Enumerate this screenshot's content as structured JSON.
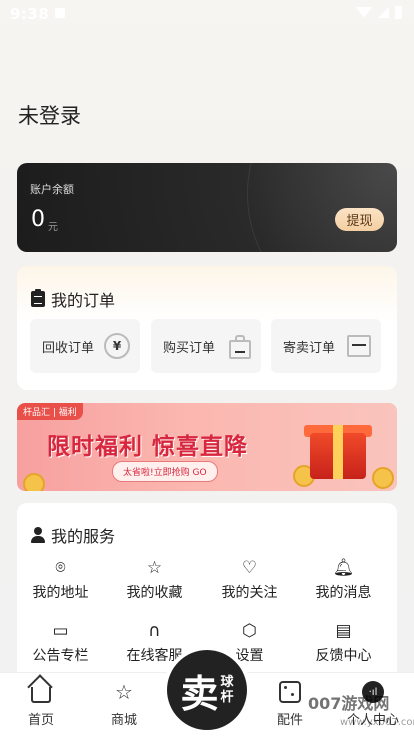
{
  "status_bar": {
    "time": "9:38"
  },
  "profile": {
    "login_status": "未登录"
  },
  "balance": {
    "label": "账户余额",
    "amount": "0",
    "unit": "元",
    "withdraw_label": "提现"
  },
  "orders": {
    "title": "我的订单",
    "items": [
      {
        "label": "回收订单",
        "icon": "yen-icon"
      },
      {
        "label": "购买订单",
        "icon": "shopping-bag-icon"
      },
      {
        "label": "寄卖订单",
        "icon": "box-icon"
      }
    ]
  },
  "banner": {
    "tag": "杆品汇 | 福利",
    "headline": "限时福利  惊喜直降",
    "pill": "太省啦!立即抢购 GO"
  },
  "services": {
    "title": "我的服务",
    "items": [
      {
        "label": "我的地址",
        "icon": "location-pin-icon"
      },
      {
        "label": "我的收藏",
        "icon": "star-icon"
      },
      {
        "label": "我的关注",
        "icon": "heart-icon"
      },
      {
        "label": "我的消息",
        "icon": "bell-icon"
      },
      {
        "label": "公告专栏",
        "icon": "announcement-icon"
      },
      {
        "label": "在线客服",
        "icon": "headset-icon"
      },
      {
        "label": "设置",
        "icon": "settings-hex-icon"
      },
      {
        "label": "反馈中心",
        "icon": "feedback-icon"
      }
    ]
  },
  "tabbar": {
    "items": [
      {
        "label": "首页",
        "icon": "home-icon"
      },
      {
        "label": "商城",
        "icon": "star-icon"
      },
      {
        "label": "配件",
        "icon": "dice-icon"
      },
      {
        "label": "个人中心",
        "icon": "profile-icon"
      }
    ],
    "center": {
      "main": "卖",
      "sub_top": "球",
      "sub_bottom": "杆"
    }
  },
  "watermark": {
    "text": "007游戏网",
    "url": "www.yx007.com"
  }
}
